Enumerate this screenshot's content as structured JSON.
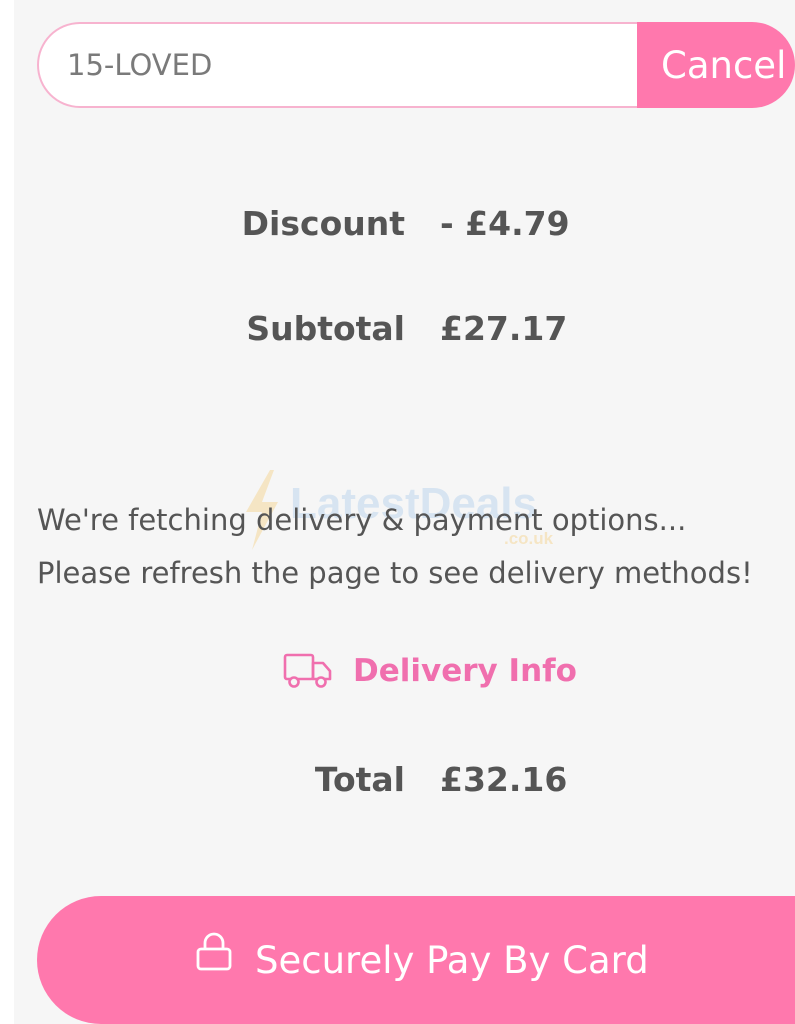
{
  "coupon": {
    "code": "15-LOVED",
    "cancel_label": "Cancel"
  },
  "summary": {
    "discount_label": "Discount",
    "discount_value": "- £4.79",
    "subtotal_label": "Subtotal",
    "subtotal_value": "£27.17",
    "total_label": "Total",
    "total_value": "£32.16"
  },
  "notice": {
    "line1": "We're fetching delivery & payment options...",
    "line2": "Please refresh the page to see delivery methods!"
  },
  "watermark": {
    "brand": "LatestDeals",
    "domain": ".co.uk"
  },
  "delivery": {
    "label": "Delivery Info",
    "icon": "truck-icon"
  },
  "payment": {
    "label": "Securely Pay By Card",
    "icon": "lock-icon"
  },
  "colors": {
    "accent": "#ff78ad",
    "link": "#f06fae",
    "text": "#555555",
    "background": "#f6f6f6"
  }
}
